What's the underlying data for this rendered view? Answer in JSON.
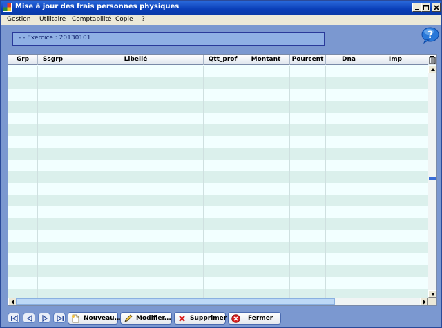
{
  "window": {
    "title": "Mise à jour des frais personnes physiques"
  },
  "menu": {
    "items": [
      {
        "label": "Gestion"
      },
      {
        "label": "Utilitaire"
      },
      {
        "label": "Comptabilité"
      },
      {
        "label": "Copie"
      },
      {
        "label": "?"
      }
    ]
  },
  "exercice": {
    "text": "- - Exercice : 20130101"
  },
  "grid": {
    "columns": [
      "Grp",
      "Ssgrp",
      "Libellé",
      "Qtt_prof",
      "Montant",
      "Pourcent",
      "Dna",
      "Imp"
    ],
    "rows": []
  },
  "toolbar": {
    "new_label": "Nouveau...",
    "edit_label": "Modifier...",
    "delete_label": "Supprimer",
    "close_label": "Fermer"
  },
  "icons": {
    "help": "help-icon",
    "trash": "trash-icon",
    "new": "new-document-icon",
    "edit": "pencil-icon",
    "delete": "red-x-icon",
    "close": "close-circle-icon"
  },
  "colors": {
    "title_bar": "#0a3fb8",
    "window_bg": "#7b98d0",
    "row_alt": "#dbf0ec",
    "row_plain": "#f2ffff",
    "delete_red": "#d81e1e"
  }
}
